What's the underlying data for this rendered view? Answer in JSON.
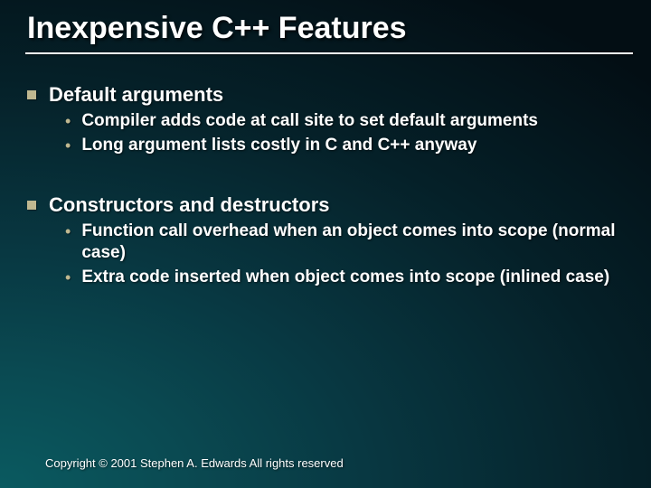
{
  "title": "Inexpensive C++ Features",
  "sections": [
    {
      "heading": "Default arguments",
      "items": [
        "Compiler adds code at call site to set default arguments",
        "Long argument lists costly in C and C++ anyway"
      ]
    },
    {
      "heading": "Constructors and destructors",
      "items": [
        "Function call overhead when an object comes into scope (normal case)",
        "Extra code inserted when object comes into scope (inlined case)"
      ]
    }
  ],
  "footer": "Copyright © 2001 Stephen A. Edwards  All rights reserved"
}
